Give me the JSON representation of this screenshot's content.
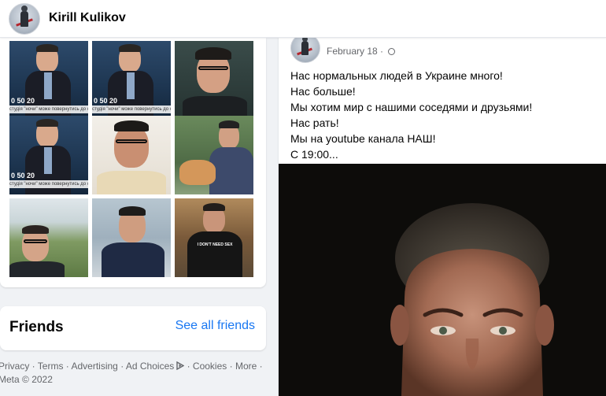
{
  "header": {
    "profile_name": "Kirill Kulikov",
    "avatar_icon": "hockey-player-avatar"
  },
  "photos": {
    "tiles": [
      {
        "caption": "студія \"ночи\" може повернутись до охотою",
        "overlay": "0 50 20"
      },
      {
        "caption": "студія \"ночи\" може повернутись до охотою",
        "overlay": "0 50 20"
      },
      {
        "caption": "",
        "overlay": ""
      },
      {
        "caption": "студія \"ночи\" може повернутись до охотою",
        "overlay": "0 50 20"
      },
      {
        "caption": "",
        "overlay": ""
      },
      {
        "caption": "",
        "overlay": ""
      },
      {
        "caption": "",
        "overlay": ""
      },
      {
        "caption": "",
        "overlay": ""
      },
      {
        "caption": "",
        "overlay": "I DON'T NEED SEX"
      }
    ]
  },
  "friends": {
    "title": "Friends",
    "see_all": "See all friends"
  },
  "footer": {
    "privacy": "Privacy",
    "terms": "Terms",
    "advertising": "Advertising",
    "ad_choices": "Ad Choices",
    "cookies": "Cookies",
    "more": "More",
    "copyright": "Meta © 2022",
    "sep": " · "
  },
  "post": {
    "date": "February 18",
    "privacy_icon": "globe-icon",
    "lines": [
      "Нас нормальных людей в Украине много!",
      "Нас больше!",
      "Мы хотим мир с нашими соседями и друзьями!",
      "Нас рать!",
      "Мы на youtube канала НАШ!",
      "С 19:00..."
    ]
  },
  "colors": {
    "link": "#1877f2",
    "background": "#f0f2f5",
    "secondary_text": "#65676b"
  }
}
